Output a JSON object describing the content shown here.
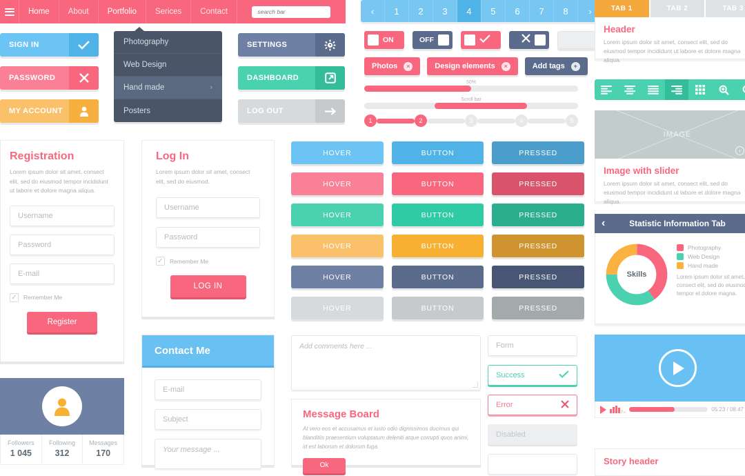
{
  "topnav": {
    "menu_icon": "hamburger-icon",
    "items": [
      {
        "label": "Home",
        "active": true
      },
      {
        "label": "About",
        "active": false
      },
      {
        "label": "Portfolio",
        "active": true
      },
      {
        "label": "Serices",
        "active": false
      },
      {
        "label": "Contact",
        "active": false
      }
    ],
    "search_placeholder": "search bar"
  },
  "auth_buttons": [
    {
      "label": "SIGN IN",
      "icon": "check-icon",
      "bg": "#6cc4f5",
      "icon_bg": "#4fb3e8"
    },
    {
      "label": "PASSWORD",
      "icon": "close-icon",
      "bg": "#fa8098",
      "icon_bg": "#f9677e"
    },
    {
      "label": "MY ACCOUNT",
      "icon": "user-icon",
      "bg": "#fbc06a",
      "icon_bg": "#f7b03f"
    }
  ],
  "dropdown": {
    "items": [
      {
        "label": "Photography",
        "chevron": false,
        "highlight": false
      },
      {
        "label": "Web Design",
        "chevron": false,
        "highlight": false
      },
      {
        "label": "Hand made",
        "chevron": true,
        "highlight": true
      },
      {
        "label": "Posters",
        "chevron": false,
        "highlight": false
      }
    ]
  },
  "action_buttons": [
    {
      "label": "SETTINGS",
      "icon": "gear-icon",
      "bg": "#6f80a5",
      "icon_bg": "#5b6b8c"
    },
    {
      "label": "DASHBOARD",
      "icon": "external-link-icon",
      "bg": "#4ad2b0",
      "icon_bg": "#34bd9b"
    },
    {
      "label": "LOG OUT",
      "icon": "arrow-right-icon",
      "bg": "#d7dadc",
      "icon_bg": "#c6cacd"
    }
  ],
  "pagination": {
    "prev": "‹",
    "pages": [
      "1",
      "2",
      "3",
      "4",
      "5",
      "6",
      "7",
      "8"
    ],
    "active_page": "4",
    "next": "›"
  },
  "toggles": [
    {
      "label": "ON",
      "state": "on",
      "bg": "#f9677e",
      "knob_side": "left"
    },
    {
      "label": "OFF",
      "state": "off",
      "bg": "#5b6b8c",
      "knob_side": "right"
    },
    {
      "label": "check-icon",
      "state": "on",
      "bg": "#f9677e",
      "knob_side": "left"
    },
    {
      "label": "close-icon",
      "state": "off",
      "bg": "#5b6b8c",
      "knob_side": "right"
    },
    {
      "label": "",
      "state": "empty",
      "bg": "#eceef0",
      "knob_side": "none"
    }
  ],
  "tags": [
    {
      "label": "Photos",
      "icon": "remove-circle-icon",
      "bg": "#f9677e"
    },
    {
      "label": "Design elements",
      "icon": "remove-circle-icon",
      "bg": "#f9677e"
    },
    {
      "label": "Add tags",
      "icon": "add-circle-icon",
      "bg": "#5b6b8c"
    }
  ],
  "progress": {
    "label": "50%",
    "percent": 50
  },
  "scrollbar": {
    "label": "Scroll bar",
    "start_percent": 33,
    "width_percent": 43
  },
  "stepper": {
    "steps": [
      "1",
      "2",
      "3",
      "4",
      "5"
    ],
    "current": 2
  },
  "tabs_card": {
    "tabs": [
      {
        "label": "TAB 1",
        "active": true
      },
      {
        "label": "TAB 2",
        "active": false
      },
      {
        "label": "TAB 3",
        "active": false
      }
    ],
    "header": "Header",
    "body": "Lorem ipsum dolor sit amet, consect elit, sed do eiusmod tempor incididunt ut labore et dolore magna aliqua."
  },
  "icon_toolbar": {
    "icons": [
      {
        "name": "align-left-icon",
        "active": false
      },
      {
        "name": "align-center-icon",
        "active": false
      },
      {
        "name": "align-justify-icon",
        "active": false
      },
      {
        "name": "align-right-icon",
        "active": true
      },
      {
        "name": "grid-icon",
        "active": false
      },
      {
        "name": "zoom-in-icon",
        "active": false
      },
      {
        "name": "zoom-out-icon",
        "active": false
      }
    ]
  },
  "image_slider": {
    "placeholder_text": "IMAGE",
    "prev": "‹",
    "next": "›",
    "header": "Image with slider",
    "body": "Lorem ipsum dolor sit amet, consect elit, sed do eiusmod tempor incididunt ut labore et dolore magna aliqua."
  },
  "statistic_tab": {
    "title": "Statistic Information Tab",
    "prev": "‹",
    "next": "›",
    "donut_center": "Skills",
    "body": "Lorem ipsum dolor sit amet, consect elit, sed do eiusmod tempor et dolore magna."
  },
  "chart_data": {
    "type": "pie",
    "title": "Skills",
    "categories": [
      "Photography",
      "Web Design",
      "Hand made"
    ],
    "values": [
      40,
      35,
      25
    ],
    "colors": [
      "#f9677e",
      "#4ad2b0",
      "#fbb13f"
    ],
    "legend_position": "right",
    "donut": true
  },
  "registration": {
    "title": "Registration",
    "body": "Lorem ipsum dolor sit amet, consect elit, sed do eiusmod tempor incididunt ut labore et dolore magna aliqua.",
    "fields": [
      "Username",
      "Password",
      "E-mail"
    ],
    "remember_label": "Remember Me",
    "submit_label": "Register"
  },
  "login": {
    "title": "Log In",
    "body": "Lorem ipsum dolor sit amet, consect elit, sed do eiusmod.",
    "fields": [
      "Username",
      "Password"
    ],
    "remember_label": "Remember Me",
    "submit_label": "LOG IN"
  },
  "contact": {
    "title": "Contact Me",
    "fields": [
      "E-mail",
      "Subject"
    ],
    "message_placeholder": "Your message ..."
  },
  "profile": {
    "avatar_icon": "user-icon",
    "stats": [
      {
        "key": "Followers",
        "value": "1 045"
      },
      {
        "key": "Following",
        "value": "312"
      },
      {
        "key": "Messages",
        "value": "170"
      }
    ]
  },
  "button_matrix": {
    "column_labels": [
      "HOVER",
      "BUTTON",
      "PRESSED"
    ],
    "rows": [
      {
        "name": "blue",
        "hover": "#6cc4f5",
        "button": "#4fb3e8",
        "pressed": "#4b9ecb"
      },
      {
        "name": "pink",
        "hover": "#fa8098",
        "button": "#f9677e",
        "pressed": "#d9536a"
      },
      {
        "name": "teal",
        "hover": "#4ad2b0",
        "button": "#2ecba4",
        "pressed": "#2aae8d"
      },
      {
        "name": "orange",
        "hover": "#fbc06a",
        "button": "#f8b033",
        "pressed": "#cf9430"
      },
      {
        "name": "slate",
        "hover": "#6f80a5",
        "button": "#5b6b8c",
        "pressed": "#485574"
      },
      {
        "name": "grey",
        "hover": "#d7dadc",
        "button": "#c6cacd",
        "pressed": "#a4a9ac"
      }
    ]
  },
  "comments": {
    "placeholder": "Add comments here ..."
  },
  "message_board": {
    "title": "Message Board",
    "body": "At vero eos et accusamus et iusto odio dignissimos ducimus qui blanditiis praesentium voluptatum deleniti atque corrupti quos animi, id est laborum et dolorum fuga.",
    "button_label": "Ok"
  },
  "form_states": [
    {
      "label": "Form",
      "state": "default",
      "icon": ""
    },
    {
      "label": "Success",
      "state": "success",
      "icon": "check-icon"
    },
    {
      "label": "Error",
      "state": "error",
      "icon": "close-icon"
    },
    {
      "label": "Disabled",
      "state": "disabled",
      "icon": ""
    }
  ],
  "video": {
    "play_icon": "play-icon",
    "time": "05:23 / 08:47",
    "volume_icon": "volume-icon",
    "played_percent": 58
  },
  "story": {
    "header": "Story header"
  }
}
